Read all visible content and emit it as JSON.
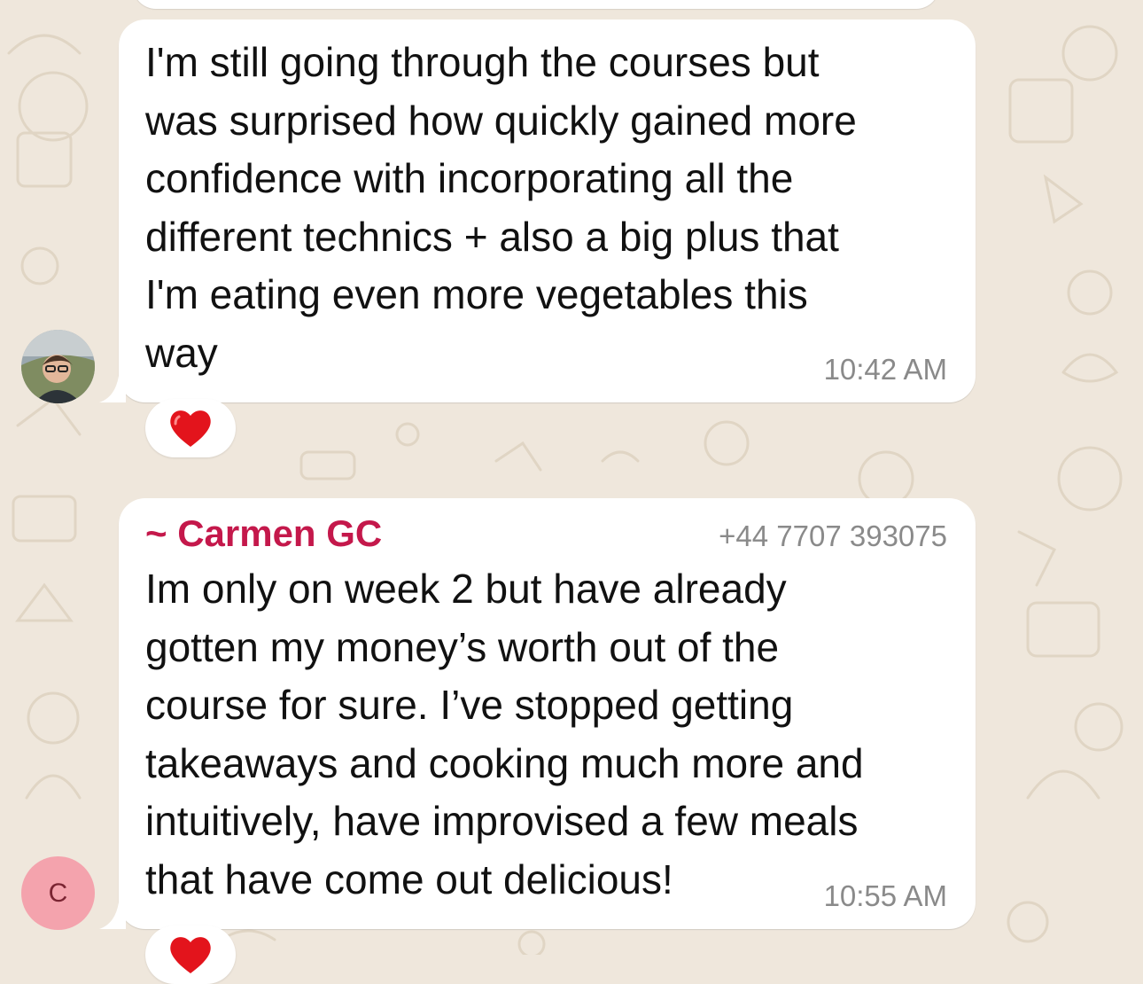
{
  "messages": [
    {
      "text": "I'm still going through the courses but\nwas surprised how quickly gained more\nconfidence with incorporating all the\ndifferent technics + also a big plus that\nI'm eating even more vegetables this\nway",
      "time": "10:42 AM",
      "reaction": "heart"
    },
    {
      "sender_name": "~ Carmen GC",
      "sender_phone": "+44 7707 393075",
      "avatar_initial": "C",
      "text": "Im only on week 2 but have already\ngotten my money’s worth out of the\ncourse for sure. I’ve stopped getting\ntakeaways and cooking much more and\nintuitively, have improvised a few meals\nthat have come out delicious!",
      "time": "10:55 AM",
      "reaction": "heart"
    }
  ],
  "colors": {
    "chat_background": "#efe7dc",
    "bubble": "#ffffff",
    "sender_name": "#c4184b",
    "timestamp": "#8a8a8a",
    "avatar_initial_bg": "#f4a3ad"
  }
}
